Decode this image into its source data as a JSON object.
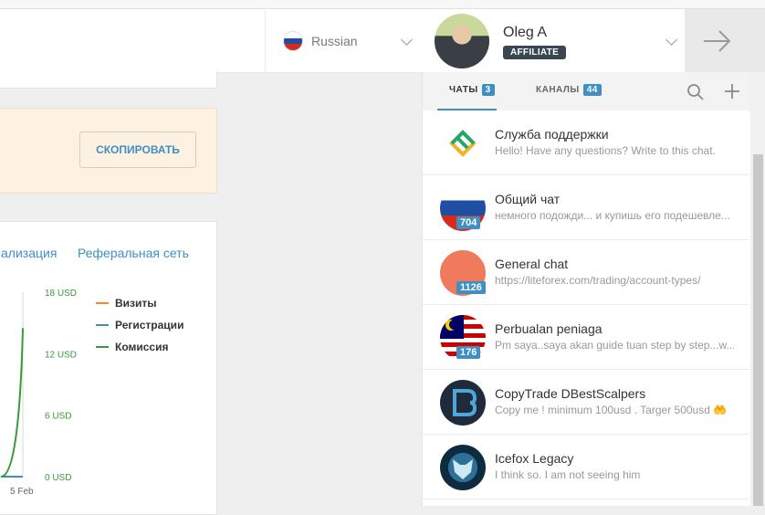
{
  "language": {
    "label": "Russian"
  },
  "user": {
    "name": "Oleg A",
    "role": "AFFILIATE"
  },
  "notice": {
    "copy_button": "СКОПИРОВАТЬ"
  },
  "report_tabs": [
    "ализация",
    "Реферальная сеть"
  ],
  "chart_data": {
    "type": "line",
    "x": [
      "",
      "5 Feb"
    ],
    "yticks": [
      "0 USD",
      "6 USD",
      "12 USD",
      "18 USD"
    ],
    "ylim": [
      0,
      18
    ],
    "series": [
      {
        "name": "Визиты",
        "color": "#f28a2e",
        "values": [
          0,
          0
        ]
      },
      {
        "name": "Регистрации",
        "color": "#3f8fc3",
        "values": [
          0,
          0
        ]
      },
      {
        "name": "Комиссия",
        "color": "#3a9a3a",
        "values": [
          0,
          14.5
        ]
      }
    ],
    "legend_position": "right",
    "colors": {
      "axis_tick_text": "#3a9a3a"
    }
  },
  "chat_panel": {
    "tabs": [
      {
        "label": "ЧАТЫ",
        "count": "3",
        "active": true
      },
      {
        "label": "КАНАЛЫ",
        "count": "44",
        "active": false
      }
    ],
    "chats": [
      {
        "name": "Служба поддержки",
        "message": "Hello! Have any questions? Write to this chat.",
        "unread": ""
      },
      {
        "name": "Общий чат",
        "message": "немного подожди... и купишь его подешевле...",
        "unread": "704"
      },
      {
        "name": "General chat",
        "message": "https://liteforex.com/trading/account-types/",
        "unread": "1126"
      },
      {
        "name": "Perbualan peniaga",
        "message": "Pm saya..saya akan guide tuan step by step...w...",
        "unread": "176"
      },
      {
        "name": "CopyTrade DBestScalpers",
        "message": "Copy me ! minimum 100usd . Targer 500usd 🤲",
        "unread": ""
      },
      {
        "name": "Icefox Legacy",
        "message": "I think so. I am not seeing him",
        "unread": ""
      }
    ]
  }
}
